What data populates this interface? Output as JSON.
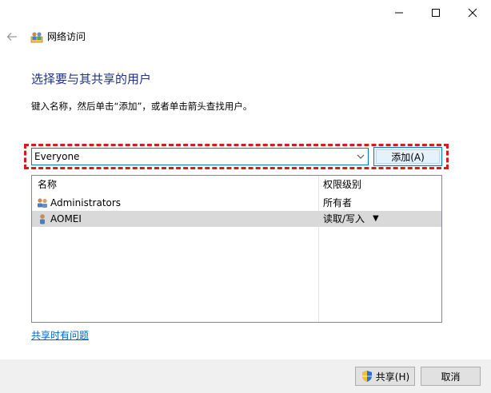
{
  "window": {
    "minimize_icon": "minimize-icon",
    "maximize_icon": "maximize-icon",
    "close_icon": "close-icon"
  },
  "nav": {
    "back_icon": "back-arrow-icon",
    "title_icon": "network-users-icon",
    "title": "网络访问"
  },
  "main": {
    "heading": "选择要与其共享的用户",
    "instruction": "键入名称，然后单击“添加”，或者单击箭头查找用户。"
  },
  "picker": {
    "input_value": "Everyone",
    "dropdown_icon": "chevron-down-icon",
    "add_button": "添加(A)"
  },
  "table": {
    "columns": [
      "名称",
      "权限级别"
    ],
    "rows": [
      {
        "name": "Administrators",
        "permission": "所有者",
        "icon": "user-group-icon",
        "selected": false
      },
      {
        "name": "AOMEI",
        "permission": "读取/写入",
        "icon": "user-icon",
        "selected": true,
        "has_dropdown": true
      }
    ]
  },
  "help_link": "共享时有问题",
  "footer": {
    "share_button": "共享(H)",
    "cancel_button": "取消"
  },
  "colors": {
    "heading": "#1e3287",
    "accent": "#0078d7",
    "highlight": "#d51c1c",
    "link": "#0066cc",
    "selected_row": "#d9d9d9"
  }
}
